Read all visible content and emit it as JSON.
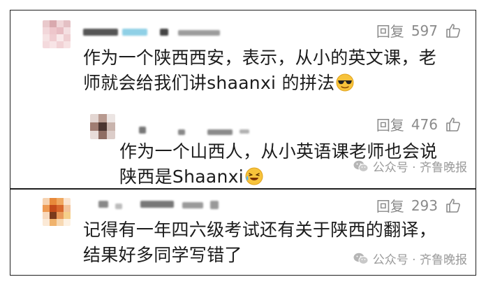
{
  "comments": [
    {
      "reply_label": "回复",
      "like_count": "597",
      "text_line1": "作为一个陕西西安，表示，从小的英文课，老",
      "text_line2": "师就会给我们讲shaanxi 的拼法",
      "emoji": "sunglasses-emoji"
    },
    {
      "reply_label": "回复",
      "like_count": "476",
      "text_line1": "作为一个山西人，从小英语课老师也会说",
      "text_line2": "陕西是Shaanxi",
      "emoji": "laughing-emoji"
    },
    {
      "reply_label": "回复",
      "like_count": "293",
      "text_line1": "记得有一年四六级考试还有关于陕西的翻译，",
      "text_line2": "结果好多同学写错了"
    }
  ],
  "watermark": {
    "text": "公众号 · 齐鲁晚报"
  },
  "colors": {
    "meta_gray": "#8a8a8a",
    "border": "#1f1f1f"
  }
}
